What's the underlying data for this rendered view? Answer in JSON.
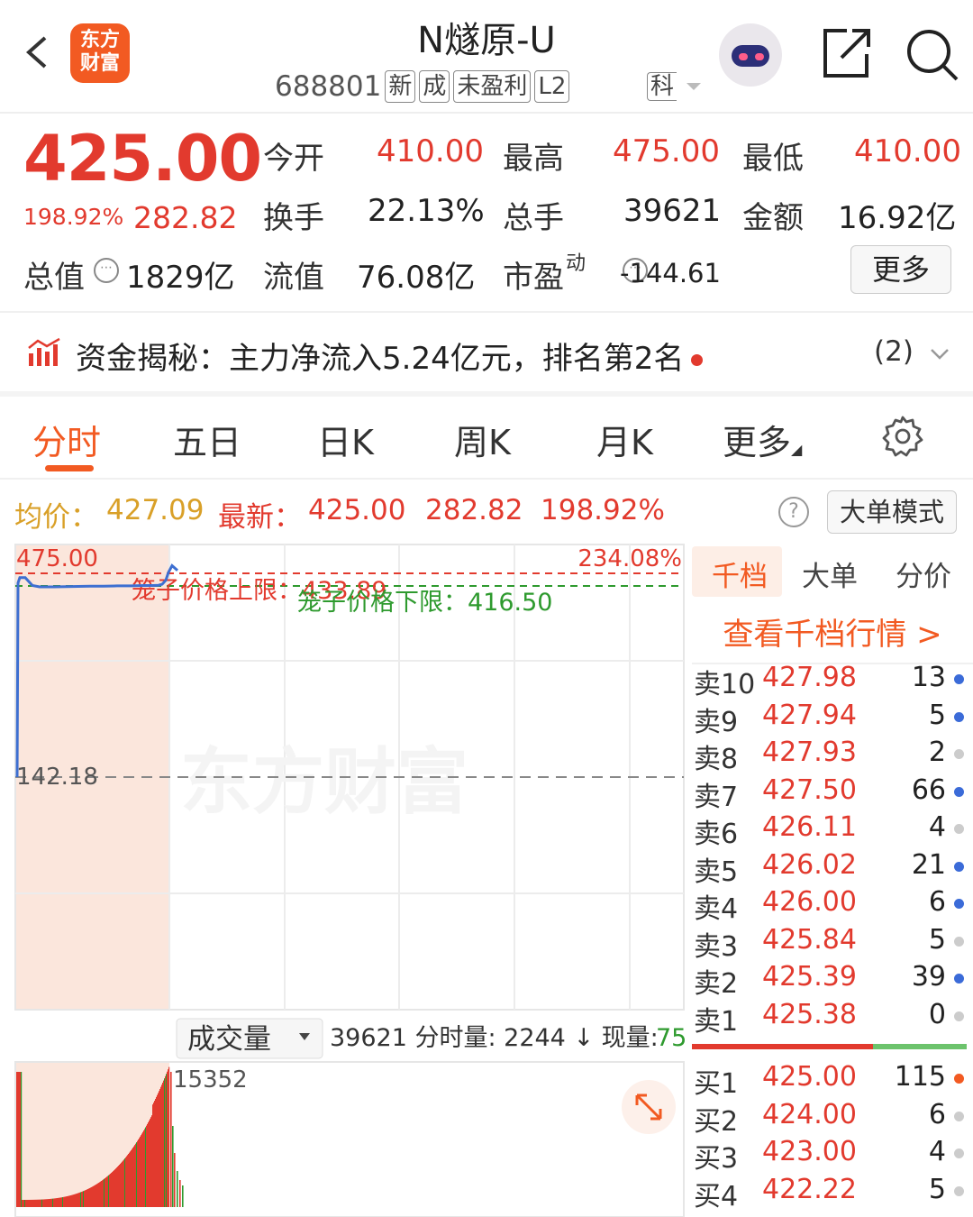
{
  "header": {
    "logo_line1": "东方",
    "logo_line2": "财富",
    "title": "N燧原-U",
    "code": "688801",
    "tags": [
      "新",
      "成",
      "未盈利",
      "L2"
    ],
    "board": "科"
  },
  "quote": {
    "price": "425.00",
    "change_pct": "198.92%",
    "change": "282.82",
    "fields": {
      "open_label": "今开",
      "open": "410.00",
      "high_label": "最高",
      "high": "475.00",
      "low_label": "最低",
      "low": "410.00",
      "turnover_label": "换手",
      "turnover": "22.13%",
      "volume_label": "总手",
      "volume": "39621",
      "amount_label": "金额",
      "amount": "16.92亿",
      "mktcap_label": "总值",
      "mktcap": "1829亿",
      "float_label": "流值",
      "float": "76.08亿",
      "pe_label": "市盈",
      "pe_sup": "动",
      "pe": "-144.61"
    },
    "more_label": "更多"
  },
  "funds": {
    "text": "资金揭秘：主力净流入5.24亿元，排名第2名",
    "count": "(2)"
  },
  "tabs": [
    "分时",
    "五日",
    "日K",
    "周K",
    "月K",
    "更多"
  ],
  "avg_line": {
    "avg_label": "均价：",
    "avg": "427.09",
    "latest_label": "最新：",
    "latest": "425.00",
    "change": "282.82",
    "pct": "198.92%",
    "mode_label": "大单模式"
  },
  "chart_data": {
    "type": "line",
    "price_max_label": "475.00",
    "pct_max_label": "234.08%",
    "base_label": "142.18",
    "upper_limit_label": "笼子价格上限：433.89",
    "lower_limit_label": "笼子价格下限：416.50",
    "watermark": "东方财富",
    "ylim": [
      142.18,
      475.0
    ],
    "series": [
      {
        "x": [
          0,
          1,
          2,
          3,
          4,
          5,
          6,
          7,
          8,
          9,
          10,
          11,
          12,
          13,
          14,
          15,
          16,
          17,
          18,
          19,
          20
        ],
        "values": [
          142.18,
          436.0,
          444.0,
          444.0,
          432.0,
          430.0,
          430.0,
          430.0,
          430.5,
          431.0,
          431.0,
          431.5,
          431.5,
          432.0,
          432.0,
          432.5,
          434.0,
          440.0,
          452.0,
          462.0,
          455.0
        ]
      }
    ],
    "volume": {
      "selector_label": "成交量",
      "summary": "39621 分时量: 2244 ↓ 现量: ",
      "current": "75",
      "max_label": "15352"
    }
  },
  "order_book": {
    "tabs": [
      "千档",
      "大单",
      "分价"
    ],
    "view_more": "查看千档行情 >",
    "sells": [
      {
        "label": "卖10",
        "price": "427.98",
        "vol": "13",
        "dot": "blue"
      },
      {
        "label": "卖9",
        "price": "427.94",
        "vol": "5",
        "dot": "blue"
      },
      {
        "label": "卖8",
        "price": "427.93",
        "vol": "2",
        "dot": "gray"
      },
      {
        "label": "卖7",
        "price": "427.50",
        "vol": "66",
        "dot": "blue"
      },
      {
        "label": "卖6",
        "price": "426.11",
        "vol": "4",
        "dot": "gray"
      },
      {
        "label": "卖5",
        "price": "426.02",
        "vol": "21",
        "dot": "blue"
      },
      {
        "label": "卖4",
        "price": "426.00",
        "vol": "6",
        "dot": "blue"
      },
      {
        "label": "卖3",
        "price": "425.84",
        "vol": "5",
        "dot": "gray"
      },
      {
        "label": "卖2",
        "price": "425.39",
        "vol": "39",
        "dot": "blue"
      },
      {
        "label": "卖1",
        "price": "425.38",
        "vol": "0",
        "dot": "gray"
      }
    ],
    "buys": [
      {
        "label": "买1",
        "price": "425.00",
        "vol": "115",
        "dot": "orange"
      },
      {
        "label": "买2",
        "price": "424.00",
        "vol": "6",
        "dot": "gray"
      },
      {
        "label": "买3",
        "price": "423.00",
        "vol": "4",
        "dot": "gray"
      },
      {
        "label": "买4",
        "price": "422.22",
        "vol": "5",
        "dot": "gray"
      }
    ],
    "buy_ratio": 0.66
  },
  "colors": {
    "accent": "#f25a22",
    "up": "#e23a2e",
    "down": "#2e9a2e",
    "line": "#3d6fd1"
  }
}
